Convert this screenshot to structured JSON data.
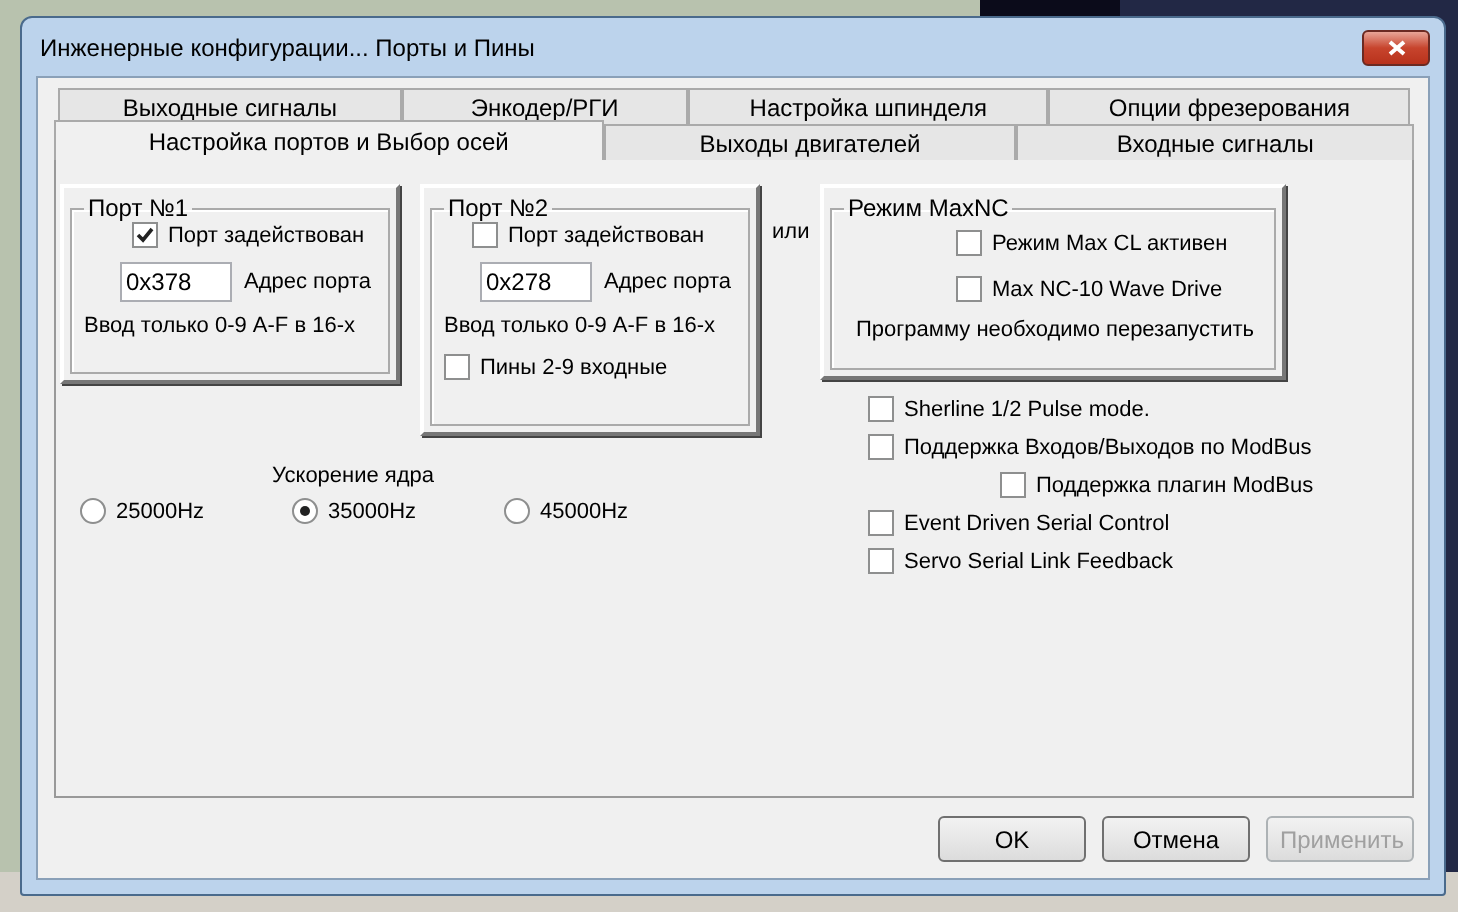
{
  "window": {
    "title": "Инженерные конфигурации... Порты и Пины"
  },
  "tabs_back": [
    {
      "label": "Выходные сигналы",
      "selected": false
    },
    {
      "label": "Энкодер/РГИ",
      "selected": false
    },
    {
      "label": "Настройка шпинделя",
      "selected": false
    },
    {
      "label": "Опции фрезерования",
      "selected": false
    }
  ],
  "tabs_front": [
    {
      "label": "Настройка портов и Выбор осей",
      "selected": true
    },
    {
      "label": "Выходы двигателей",
      "selected": false
    },
    {
      "label": "Входные сигналы",
      "selected": false
    }
  ],
  "ports": [
    {
      "title": "Порт №1",
      "enabled": {
        "label": "Порт задействован",
        "checked": true
      },
      "address": "0x378",
      "address_label": "Адрес порта",
      "hint": "Ввод только 0-9  A-F в 16-х"
    },
    {
      "title": "Порт №2",
      "enabled": {
        "label": "Порт задействован",
        "checked": false
      },
      "address": "0x278",
      "address_label": "Адрес порта",
      "hint": "Ввод только 0-9  A-F в 16-х",
      "pins": {
        "label": "Пины 2-9 входные",
        "checked": false
      }
    }
  ],
  "or_label": "или",
  "maxnc": {
    "title": "Режим MaxNC",
    "options": [
      {
        "label": "Режим Max CL активен",
        "checked": false
      },
      {
        "label": "Max NC-10 Wave Drive",
        "checked": false
      }
    ],
    "note": "Программу необходимо перезапустить"
  },
  "options": [
    {
      "label": "Sherline 1/2 Pulse mode.",
      "checked": false
    },
    {
      "label": "Поддержка Входов/Выходов по ModBus",
      "checked": false,
      "children": [
        {
          "label": "Поддержка плагин ModBus",
          "checked": false
        }
      ]
    },
    {
      "label": "Event Driven Serial Control",
      "checked": false
    },
    {
      "label": "Servo Serial Link Feedback",
      "checked": false
    }
  ],
  "speed": {
    "label": "Ускорение ядра",
    "options": [
      {
        "label": "25000Hz",
        "selected": false
      },
      {
        "label": "35000Hz",
        "selected": true
      },
      {
        "label": "45000Hz",
        "selected": false
      }
    ]
  },
  "buttons": [
    {
      "label": "OK",
      "disabled": false
    },
    {
      "label": "Отмена",
      "disabled": false
    },
    {
      "label": "Применить",
      "disabled": true
    }
  ]
}
